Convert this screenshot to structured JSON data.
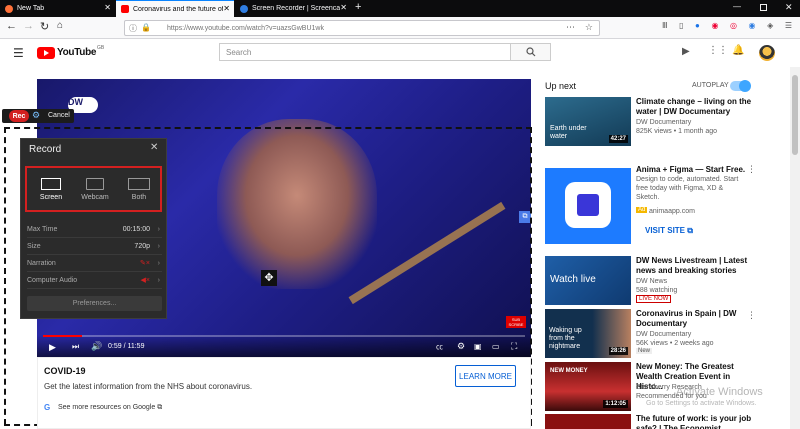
{
  "browser": {
    "tabs": [
      {
        "label": "New Tab"
      },
      {
        "label": "Coronavirus and the future of"
      },
      {
        "label": "Screen Recorder | Screencast-O"
      }
    ],
    "url": "https://www.youtube.com/watch?v=uazsGwBU1wk"
  },
  "youtube": {
    "logo_text": "YouTube",
    "region": "GB",
    "search_placeholder": "Search"
  },
  "player": {
    "channel_logo": "DW",
    "time": "0:59 / 11:59",
    "subscribe": [
      "SUB",
      "SCRIBE"
    ]
  },
  "recorder": {
    "rec_label": "Rec",
    "cancel_label": "Cancel",
    "panel_title": "Record",
    "modes": [
      "Screen",
      "Webcam",
      "Both"
    ],
    "max_time_label": "Max Time",
    "max_time_value": "00:15:00",
    "size_label": "Size",
    "size_value": "720p",
    "narration_label": "Narration",
    "computer_audio_label": "Computer Audio",
    "preferences_label": "Preferences..."
  },
  "covid": {
    "title": "COVID-19",
    "text": "Get the latest information from the NHS about coronavirus.",
    "button": "LEARN MORE",
    "link": "See more resources on Google"
  },
  "sidebar": {
    "up_next": "Up next",
    "autoplay": "AUTOPLAY",
    "videos": [
      {
        "title": "Climate change – living on the water | DW Documentary",
        "channel": "DW Documentary",
        "meta": "825K views • 1 month ago",
        "duration": "42:27",
        "thumb_text": "Earth under water"
      },
      {
        "title": "Anima + Figma — Start Free.",
        "desc": "Design to code, automated. Start free today with Figma, XD & Sketch.",
        "ad_badge": "Ad",
        "domain": "animaapp.com",
        "cta": "VISIT SITE"
      },
      {
        "title": "DW News Livestream | Latest news and breaking stories",
        "channel": "DW News",
        "meta": "588 watching",
        "badge": "LIVE NOW",
        "thumb_text": "Watch live"
      },
      {
        "title": "Coronavirus in Spain | DW Documentary",
        "channel": "DW Documentary",
        "meta": "56K views • 2 weeks ago",
        "badge": "New",
        "duration": "28:26",
        "thumb_text": "Waking up from the nightmare"
      },
      {
        "title": "New Money: The Greatest Wealth Creation Event in Histo...",
        "channel": "Stansberry Research",
        "meta": "Recommended for you",
        "duration": "1:12:05",
        "thumb_text": "NEW MONEY"
      },
      {
        "title": "The future of work: is your job safe? | The Economist"
      }
    ]
  },
  "watermark": {
    "line1": "Activate Windows",
    "line2": "Go to Settings to activate Windows."
  },
  "colors": {
    "youtube_red": "#ff0000",
    "rec_red": "#d32020",
    "link_blue": "#065fd4",
    "autoplay_blue": "#3ea6ff"
  }
}
